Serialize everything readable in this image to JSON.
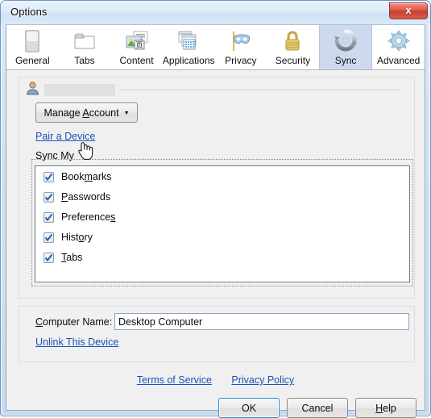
{
  "window": {
    "title": "Options",
    "close_label": "x"
  },
  "tabs": [
    {
      "label": "General",
      "icon": "general-icon",
      "selected": false
    },
    {
      "label": "Tabs",
      "icon": "tabs-icon",
      "selected": false
    },
    {
      "label": "Content",
      "icon": "content-icon",
      "selected": false
    },
    {
      "label": "Applications",
      "icon": "applications-icon",
      "selected": false
    },
    {
      "label": "Privacy",
      "icon": "privacy-mask-icon",
      "selected": false
    },
    {
      "label": "Security",
      "icon": "padlock-icon",
      "selected": false
    },
    {
      "label": "Sync",
      "icon": "sync-arrows-icon",
      "selected": true
    },
    {
      "label": "Advanced",
      "icon": "gear-icon",
      "selected": false
    }
  ],
  "account": {
    "avatar_icon": "user-avatar-icon",
    "account_name_redacted": "",
    "manage_account_label": "Manage Account",
    "manage_account_accesskey": "A",
    "manage_account_arrow": "▼",
    "pair_a_device_label": "Pair a Device"
  },
  "sync_my": {
    "group_label": "Sync My",
    "items": [
      {
        "label": "Bookmarks",
        "accesskey": "m",
        "checked": true
      },
      {
        "label": "Passwords",
        "accesskey": "P",
        "checked": true
      },
      {
        "label": "Preferences",
        "accesskey": "s",
        "checked": true
      },
      {
        "label": "History",
        "accesskey": "o",
        "checked": true
      },
      {
        "label": "Tabs",
        "accesskey": "T",
        "checked": true
      }
    ]
  },
  "device": {
    "computer_name_label": "Computer Name:",
    "computer_name_accesskey": "C",
    "computer_name_value": "Desktop Computer",
    "unlink_label": "Unlink This Device"
  },
  "footer": {
    "terms_label": "Terms of Service",
    "privacy_label": "Privacy Policy"
  },
  "buttons": {
    "ok_label": "OK",
    "cancel_label": "Cancel",
    "help_label": "Help",
    "help_accesskey": "H"
  },
  "colors": {
    "link": "#1a51b8",
    "selected_tab_bg": "#cdd9ee",
    "dialog_bg": "#f0f0f0",
    "default_button_border": "#2c8fd1",
    "close_button": "#c33f30"
  },
  "cursor": {
    "type": "pointing-hand"
  }
}
